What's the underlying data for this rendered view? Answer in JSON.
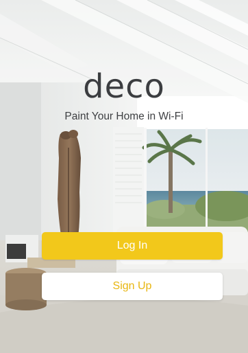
{
  "app": {
    "logo_text": "deco",
    "tagline": "Paint Your Home in Wi-Fi"
  },
  "actions": {
    "login_label": "Log In",
    "signup_label": "Sign Up"
  },
  "colors": {
    "accent": "#f2c81b",
    "signup_text": "#e8b611",
    "logo_text": "#3b3d40"
  }
}
